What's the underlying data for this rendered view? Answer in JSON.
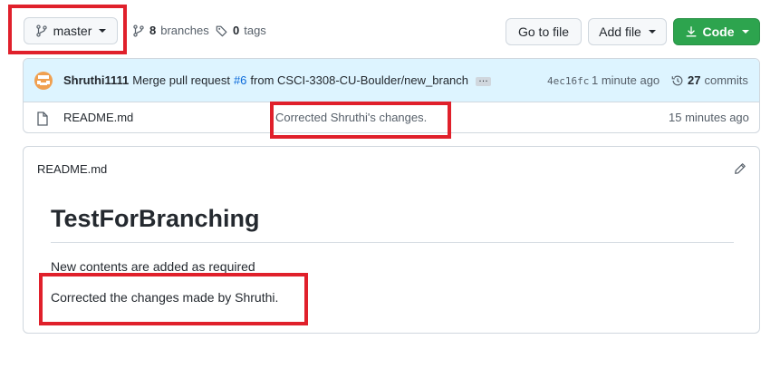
{
  "toolbar": {
    "branch_label": "master",
    "branches_count": "8",
    "branches_label": "branches",
    "tags_count": "0",
    "tags_label": "tags",
    "go_to_file": "Go to file",
    "add_file": "Add file",
    "code": "Code"
  },
  "commit": {
    "author": "Shruthi1111",
    "message_prefix": "Merge pull request",
    "pr_link": "#6",
    "message_suffix": "from CSCI-3308-CU-Boulder/new_branch",
    "ellipsis": "…",
    "sha": "4ec16fc",
    "time": "1 minute ago",
    "commits_count": "27",
    "commits_label": "commits"
  },
  "files": [
    {
      "name": "README.md",
      "message": "Corrected Shruthi's changes.",
      "time": "15 minutes ago"
    }
  ],
  "readme": {
    "header": "README.md",
    "title": "TestForBranching",
    "line1": "New contents are added as required",
    "line2": "Corrected the changes made by Shruthi."
  },
  "colors": {
    "accent_green": "#2da44e",
    "highlight_red": "#e0202b",
    "link_blue": "#0969da",
    "commit_bar_bg": "#ddf4ff"
  }
}
